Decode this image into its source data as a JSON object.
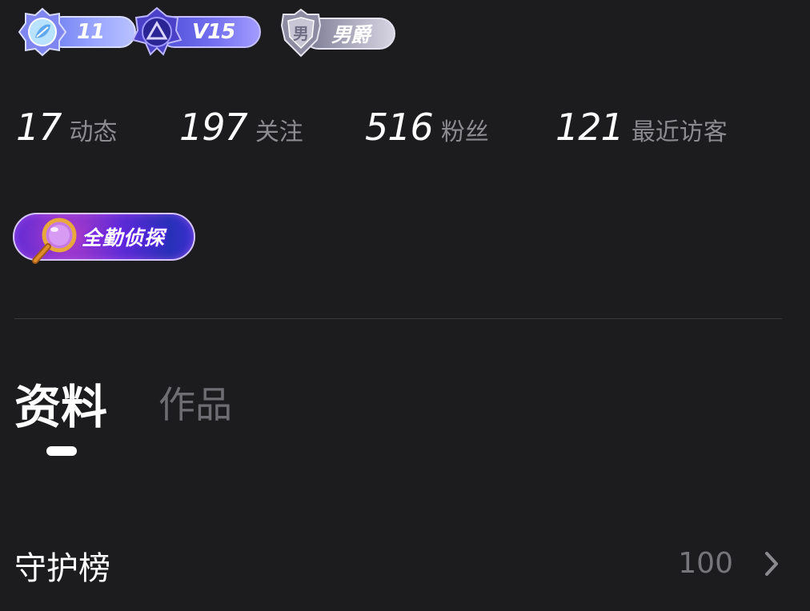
{
  "badges": {
    "level": {
      "value": "11",
      "icon": "leaf-crest-icon",
      "color": "#8f9cff"
    },
    "vip": {
      "value": "V15",
      "icon": "triangle-crest-icon",
      "color": "#6a66f0"
    },
    "title": {
      "value": "男爵",
      "icon": "shield-crest-icon",
      "emblem_text": "男",
      "color": "#b8b6c8"
    }
  },
  "stats": {
    "posts": {
      "count": "17",
      "label": "动态"
    },
    "following": {
      "count": "197",
      "label": "关注"
    },
    "fans": {
      "count": "516",
      "label": "粉丝"
    },
    "visitors": {
      "count": "121",
      "label": "最近访客"
    }
  },
  "medal": {
    "label": "全勤侦探",
    "icon": "magnifier-icon"
  },
  "tabs": [
    {
      "label": "资料",
      "active": true
    },
    {
      "label": "作品",
      "active": false
    }
  ],
  "guard_list": {
    "title": "守护榜",
    "count": "100",
    "icon": "chevron-right-icon"
  },
  "colors": {
    "background": "#1c1c1e",
    "muted_text": "#8c8c90",
    "divider": "#38383b"
  }
}
